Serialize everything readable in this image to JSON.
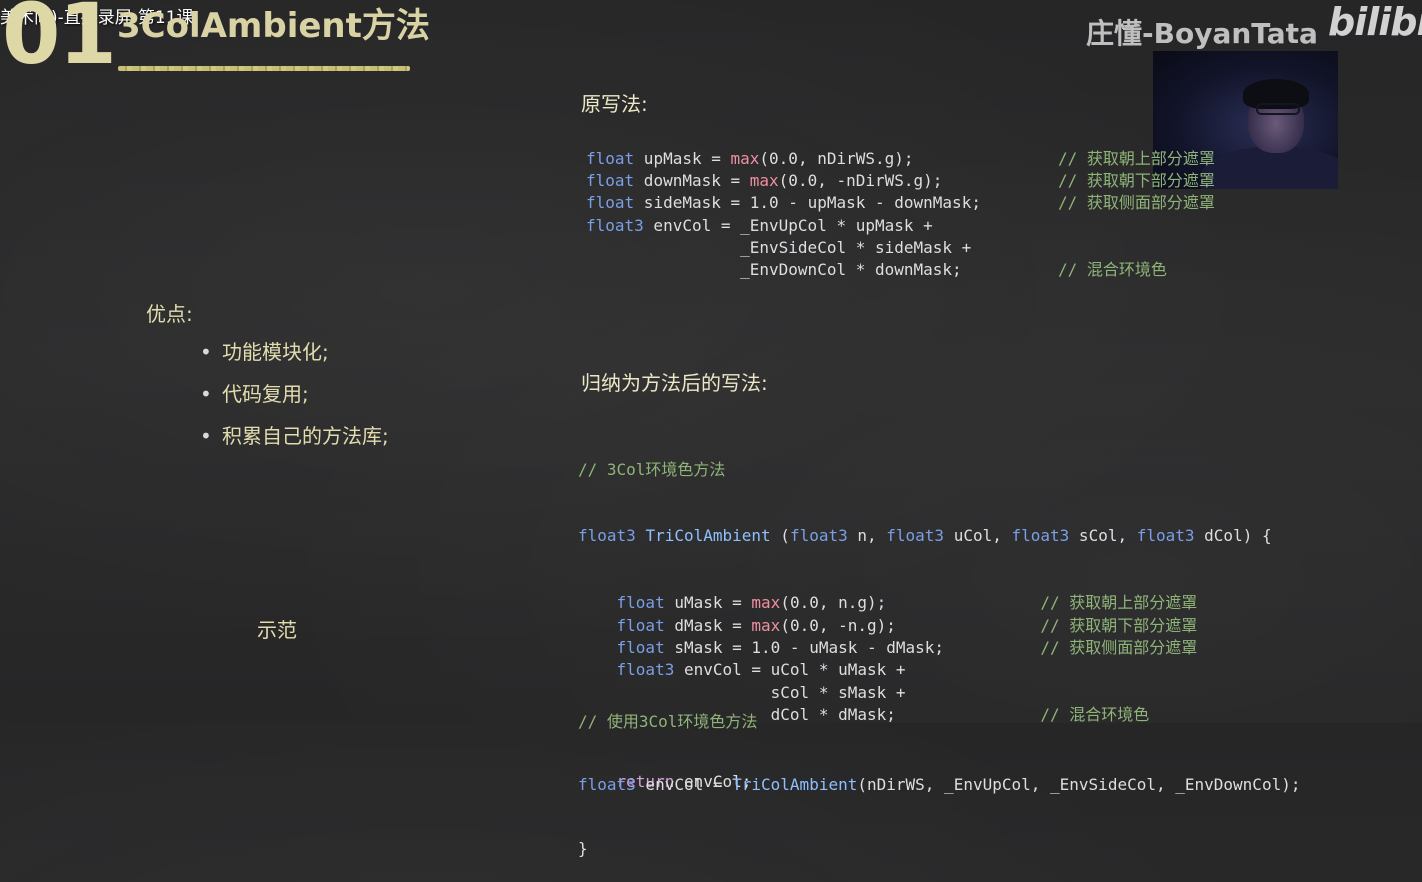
{
  "video_title": "美术向)-直播录屏-第11课",
  "slide": {
    "number": "01",
    "heading": "3ColAmbient方法",
    "author": "庄懂-BoyanTata",
    "logo": "bilibili"
  },
  "pros": {
    "title": "优点:",
    "items": [
      "功能模块化;",
      "代码复用;",
      "积累自己的方法库;"
    ],
    "bullet": "•"
  },
  "demo_label": "示范",
  "section_original": "原写法:",
  "section_method": "归纳为方法后的写法:",
  "code_original": [
    {
      "kw": "float",
      "body": " upMask = ",
      "fn": "max",
      "rest": "(0.0, nDirWS.g);",
      "comment": "// 获取朝上部分遮罩"
    },
    {
      "kw": "float",
      "body": " downMask = ",
      "fn": "max",
      "rest": "(0.0, -nDirWS.g);",
      "comment": "// 获取朝下部分遮罩"
    },
    {
      "kw": "float",
      "body": " sideMask = 1.0 - upMask - downMask;",
      "fn": "",
      "rest": "",
      "comment": "// 获取侧面部分遮罩"
    },
    {
      "kw": "float3",
      "body": " envCol = _EnvUpCol * upMask +",
      "fn": "",
      "rest": "",
      "comment": ""
    },
    {
      "kw": "",
      "body": "                _EnvSideCol * sideMask +",
      "fn": "",
      "rest": "",
      "comment": ""
    },
    {
      "kw": "",
      "body": "                _EnvDownCol * downMask;",
      "fn": "",
      "rest": "",
      "comment": "// 混合环境色"
    }
  ],
  "code_method": {
    "comment_head": "// 3Col环境色方法",
    "signature": {
      "ret_type": "float3",
      "name": "TriColAmbient",
      "params_open": " (",
      "p1_type": "float3",
      "p1": " n, ",
      "p2_type": "float3",
      "p2": " uCol, ",
      "p3_type": "float3",
      "p3": " sCol, ",
      "p4_type": "float3",
      "p4": " dCol) {"
    },
    "body": [
      {
        "kw": "float",
        "body": " uMask = ",
        "fn": "max",
        "rest": "(0.0, n.g);",
        "comment": "// 获取朝上部分遮罩"
      },
      {
        "kw": "float",
        "body": " dMask = ",
        "fn": "max",
        "rest": "(0.0, -n.g);",
        "comment": "// 获取朝下部分遮罩"
      },
      {
        "kw": "float",
        "body": " sMask = 1.0 - uMask - dMask;",
        "fn": "",
        "rest": "",
        "comment": "// 获取侧面部分遮罩"
      },
      {
        "kw": "float3",
        "body": " envCol = uCol * uMask +",
        "fn": "",
        "rest": "",
        "comment": ""
      },
      {
        "kw": "",
        "body": "                sCol * sMask +",
        "fn": "",
        "rest": "",
        "comment": ""
      },
      {
        "kw": "",
        "body": "                dCol * dMask;",
        "fn": "",
        "rest": "",
        "comment": "// 混合环境色"
      }
    ],
    "return_kw": "return",
    "return_body": " envCol;",
    "close": "}"
  },
  "code_usage": {
    "comment": "// 使用3Col环境色方法",
    "kw": "float3",
    "body_pre": " envCol = ",
    "fn": "TriColAmbient",
    "body_post": "(nDirWS, _EnvUpCol, _EnvSideCol, _EnvDownCol);"
  }
}
